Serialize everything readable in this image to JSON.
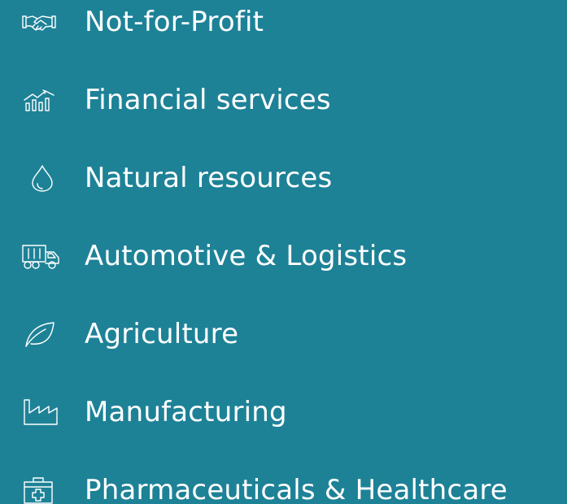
{
  "industries": {
    "items": [
      {
        "label": "Not-for-Profit",
        "icon": "handshake-icon"
      },
      {
        "label": "Financial services",
        "icon": "financial-chart-icon"
      },
      {
        "label": "Natural resources",
        "icon": "water-drop-icon"
      },
      {
        "label": "Automotive & Logistics",
        "icon": "truck-icon"
      },
      {
        "label": "Agriculture",
        "icon": "leaf-icon"
      },
      {
        "label": "Manufacturing",
        "icon": "factory-icon"
      },
      {
        "label": "Pharmaceuticals & Healthcare",
        "icon": "medical-kit-icon"
      }
    ]
  },
  "colors": {
    "background": "#1e8297",
    "text": "#ffffff"
  }
}
